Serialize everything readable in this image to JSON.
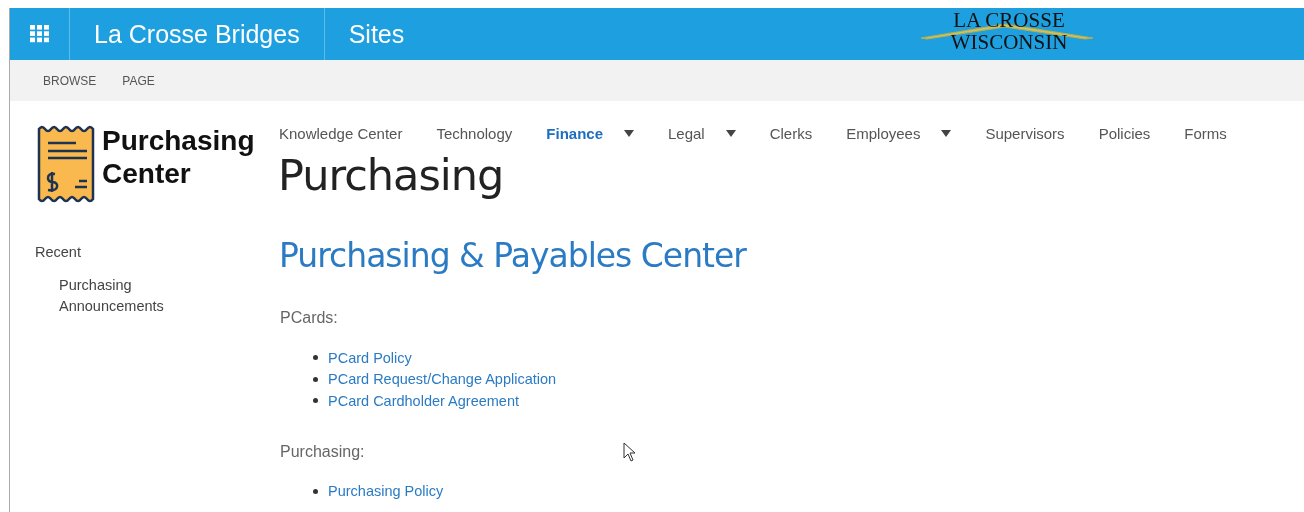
{
  "suite_bar": {
    "site_title": "La Crosse Bridges",
    "sites_link": "Sites",
    "logo": {
      "line_1": "LA CROSSE",
      "line_2": "WISCONSIN"
    }
  },
  "ribbon": {
    "tabs": [
      {
        "label": "BROWSE",
        "selected": false
      },
      {
        "label": "PAGE",
        "selected": false
      }
    ]
  },
  "site_logo": {
    "line_1": "Purchasing",
    "line_2": "Center"
  },
  "top_nav": [
    {
      "label": "Knowledge Center",
      "selected": false,
      "has_dropdown": false
    },
    {
      "label": "Technology",
      "selected": false,
      "has_dropdown": false
    },
    {
      "label": "Finance",
      "selected": true,
      "has_dropdown": true
    },
    {
      "label": "Legal",
      "selected": false,
      "has_dropdown": true
    },
    {
      "label": "Clerks",
      "selected": false,
      "has_dropdown": false
    },
    {
      "label": "Employees",
      "selected": false,
      "has_dropdown": true
    },
    {
      "label": "Supervisors",
      "selected": false,
      "has_dropdown": false
    },
    {
      "label": "Policies",
      "selected": false,
      "has_dropdown": false
    },
    {
      "label": "Forms",
      "selected": false,
      "has_dropdown": false
    }
  ],
  "page_title": "Purchasing",
  "quick_launch": {
    "heading": "Recent",
    "items": [
      "Purchasing Announcements"
    ]
  },
  "content": {
    "heading": "Purchasing & Payables Center",
    "sections": [
      {
        "title": "PCards:",
        "links": [
          "PCard Policy",
          "PCard Request/Change Application",
          "PCard Cardholder Agreement"
        ]
      },
      {
        "title": "Purchasing:",
        "links": [
          "Purchasing Policy"
        ]
      }
    ]
  }
}
